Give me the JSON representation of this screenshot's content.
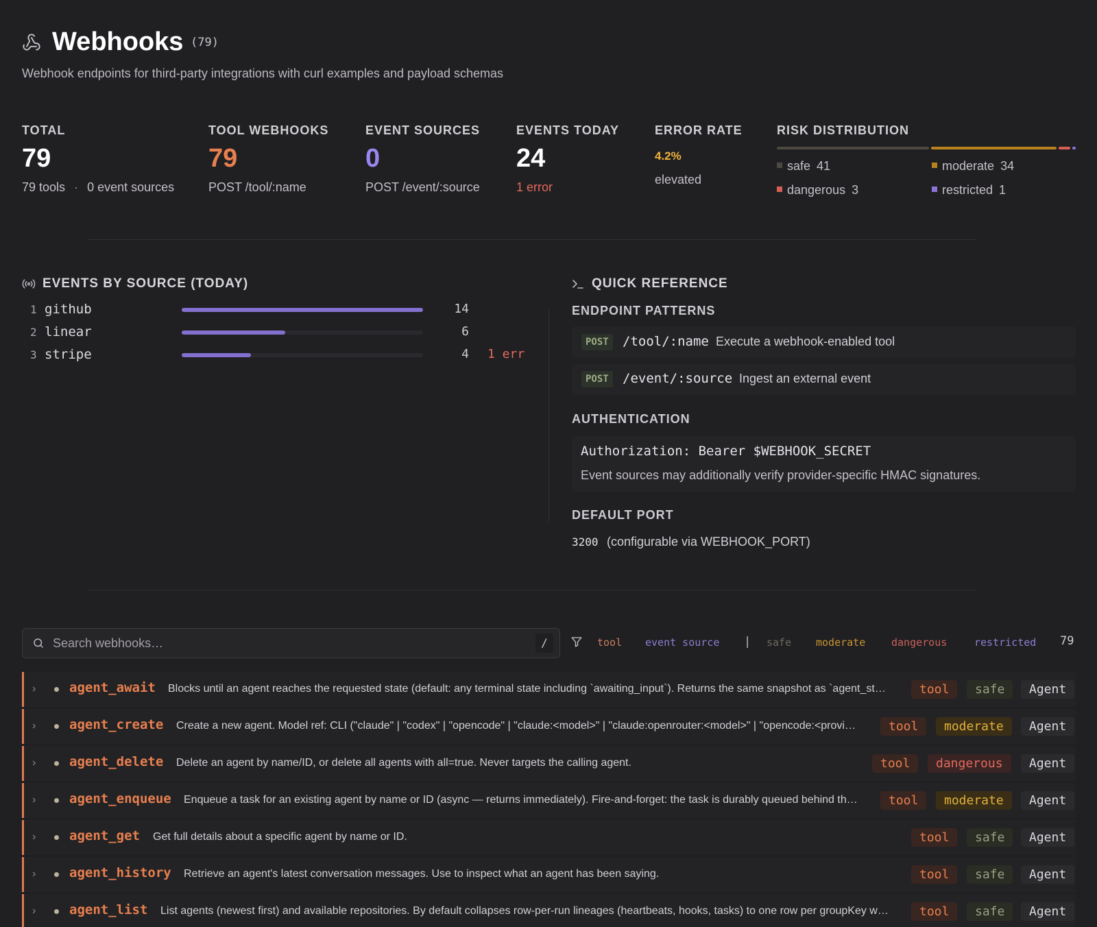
{
  "header": {
    "title": "Webhooks",
    "count": "(79)",
    "subtitle": "Webhook endpoints for third-party integrations with curl examples and payload schemas"
  },
  "stats": {
    "total": {
      "label": "TOTAL",
      "value": "79",
      "tools": "79 tools",
      "sep": "·",
      "sources": "0 event sources"
    },
    "tool_webhooks": {
      "label": "TOOL WEBHOOKS",
      "value": "79",
      "sub": "POST /tool/:name",
      "color": "#e8804f"
    },
    "event_sources": {
      "label": "EVENT SOURCES",
      "value": "0",
      "sub": "POST /event/:source",
      "color": "#9b86f0"
    },
    "events_today": {
      "label": "EVENTS TODAY",
      "value": "24",
      "sub": "1 error"
    },
    "error_rate": {
      "label": "ERROR RATE",
      "value": "4.2%",
      "sub": "elevated",
      "color": "#f0b43a"
    },
    "risk": {
      "label": "RISK DISTRIBUTION",
      "items": [
        {
          "name": "safe",
          "count": "41",
          "value": 41,
          "color": "#4c4a40"
        },
        {
          "name": "moderate",
          "count": "34",
          "value": 34,
          "color": "#b8821e"
        },
        {
          "name": "dangerous",
          "count": "3",
          "value": 3,
          "color": "#d65f55"
        },
        {
          "name": "restricted",
          "count": "1",
          "value": 1,
          "color": "#8b73d8"
        }
      ]
    }
  },
  "events_by_source": {
    "title": "EVENTS BY SOURCE (TODAY)",
    "max": 14,
    "rows": [
      {
        "idx": "1",
        "name": "github",
        "count": "14",
        "value": 14,
        "err": ""
      },
      {
        "idx": "2",
        "name": "linear",
        "count": "6",
        "value": 6,
        "err": ""
      },
      {
        "idx": "3",
        "name": "stripe",
        "count": "4",
        "value": 4,
        "err": "1 err"
      }
    ]
  },
  "quick_ref": {
    "title": "QUICK REFERENCE",
    "endpoints_title": "ENDPOINT PATTERNS",
    "endpoints": [
      {
        "method": "POST",
        "path": "/tool/:name",
        "desc": "Execute a webhook-enabled tool"
      },
      {
        "method": "POST",
        "path": "/event/:source",
        "desc": "Ingest an external event"
      }
    ],
    "auth_title": "AUTHENTICATION",
    "auth_header": "Authorization: Bearer $WEBHOOK_SECRET",
    "auth_note": "Event sources may additionally verify provider-specific HMAC signatures.",
    "port_title": "DEFAULT PORT",
    "port": "3200",
    "port_note": "(configurable via WEBHOOK_PORT)"
  },
  "search": {
    "placeholder": "Search webhooks…",
    "shortcut": "/"
  },
  "filters": {
    "chips": [
      {
        "label": "tool",
        "color": "#c9805e"
      },
      {
        "label": "event source",
        "color": "#8b7fd0"
      },
      {
        "label": "|",
        "color": "#bdbac0"
      },
      {
        "label": "safe",
        "color": "#6d6c5c"
      },
      {
        "label": "moderate",
        "color": "#c99433"
      },
      {
        "label": "dangerous",
        "color": "#c9625a"
      },
      {
        "label": "restricted",
        "color": "#8b7fd0"
      }
    ],
    "count": "79"
  },
  "rows": [
    {
      "name": "agent_await",
      "desc": "Blocks until an agent reaches the requested state (default: any terminal state including `awaiting_input`). Returns the same snapshot as `agent_st…",
      "type": "tool",
      "risk": "safe",
      "category": "Agent"
    },
    {
      "name": "agent_create",
      "desc": "Create a new agent. Model ref: CLI (\"claude\" | \"codex\" | \"opencode\" | \"claude:<model>\" | \"claude:openrouter:<model>\" | \"opencode:<provi…",
      "type": "tool",
      "risk": "moderate",
      "category": "Agent"
    },
    {
      "name": "agent_delete",
      "desc": "Delete an agent by name/ID, or delete all agents with all=true. Never targets the calling agent.",
      "type": "tool",
      "risk": "dangerous",
      "category": "Agent"
    },
    {
      "name": "agent_enqueue",
      "desc": "Enqueue a task for an existing agent by name or ID (async — returns immediately). Fire-and-forget: the task is durably queued behind th…",
      "type": "tool",
      "risk": "moderate",
      "category": "Agent"
    },
    {
      "name": "agent_get",
      "desc": "Get full details about a specific agent by name or ID.",
      "type": "tool",
      "risk": "safe",
      "category": "Agent"
    },
    {
      "name": "agent_history",
      "desc": "Retrieve an agent's latest conversation messages. Use to inspect what an agent has been saying.",
      "type": "tool",
      "risk": "safe",
      "category": "Agent"
    },
    {
      "name": "agent_list",
      "desc": "List agents (newest first) and available repositories. By default collapses row-per-run lineages (heartbeats, hooks, tasks) to one row per groupKey w…",
      "type": "tool",
      "risk": "safe",
      "category": "Agent"
    }
  ]
}
